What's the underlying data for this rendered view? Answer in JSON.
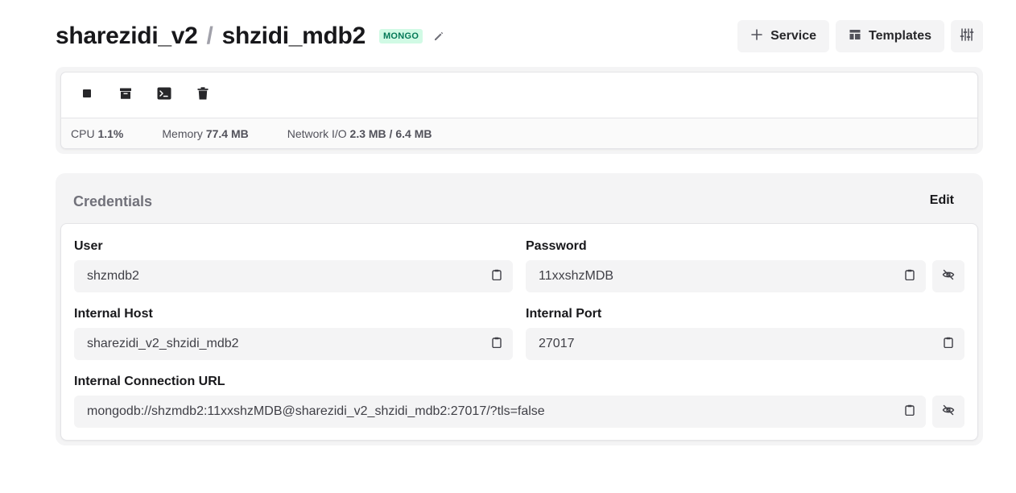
{
  "header": {
    "project": "sharezidi_v2",
    "separator": "/",
    "service": "shzidi_mdb2",
    "badge": "MONGO",
    "actions": {
      "service_label": "Service",
      "templates_label": "Templates"
    }
  },
  "stats": {
    "cpu_label": "CPU",
    "cpu_value": "1.1%",
    "memory_label": "Memory",
    "memory_value": "77.4 MB",
    "network_label": "Network I/O",
    "network_value": "2.3 MB / 6.4 MB"
  },
  "credentials": {
    "title": "Credentials",
    "edit_label": "Edit",
    "user_label": "User",
    "user_value": "shzmdb2",
    "password_label": "Password",
    "password_value": "11xxshzMDB",
    "host_label": "Internal Host",
    "host_value": "sharezidi_v2_shzidi_mdb2",
    "port_label": "Internal Port",
    "port_value": "27017",
    "url_label": "Internal Connection URL",
    "url_value": "mongodb://shzmdb2:11xxshzMDB@sharezidi_v2_shzidi_mdb2:27017/?tls=false"
  }
}
